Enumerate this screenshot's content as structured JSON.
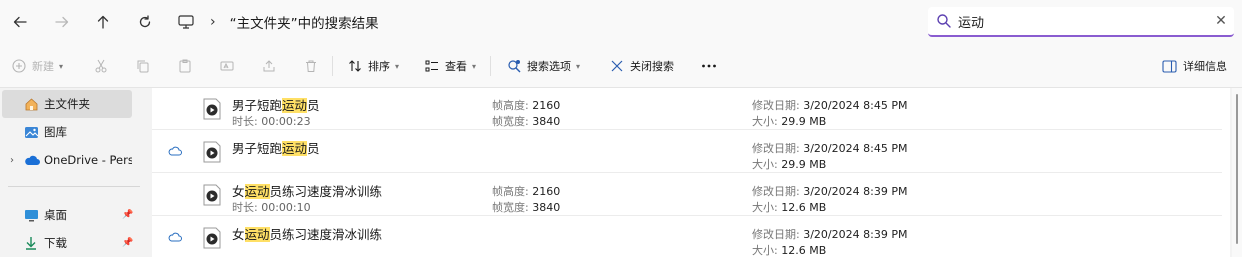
{
  "address": {
    "path": "“主文件夹”中的搜索结果"
  },
  "search": {
    "query": "运动"
  },
  "toolbar": {
    "new_label": "新建",
    "sort_label": "排序",
    "view_label": "查看",
    "search_options_label": "搜索选项",
    "close_search_label": "关闭搜索",
    "details_label": "详细信息"
  },
  "nav": {
    "home": "主文件夹",
    "gallery": "图库",
    "onedrive": "OneDrive - Persor",
    "desktop": "桌面",
    "downloads": "下载"
  },
  "files": [
    {
      "name_pre": "男子短跑",
      "name_hl": "运动",
      "name_post": "员",
      "has_duration": true,
      "duration_label": "时长:",
      "duration": "00:00:23",
      "has_dims": true,
      "height_label": "帧高度:",
      "height": "2160",
      "width_label": "帧宽度:",
      "width": "3840",
      "modified_label": "修改日期:",
      "modified": "3/20/2024 8:45 PM",
      "size_label": "大小:",
      "size": "29.9 MB",
      "cloud": false
    },
    {
      "name_pre": "男子短跑",
      "name_hl": "运动",
      "name_post": "员",
      "has_duration": false,
      "has_dims": false,
      "modified_label": "修改日期:",
      "modified": "3/20/2024 8:45 PM",
      "size_label": "大小:",
      "size": "29.9 MB",
      "cloud": true
    },
    {
      "name_pre": "女",
      "name_hl": "运动",
      "name_post": "员练习速度滑冰训练",
      "has_duration": true,
      "duration_label": "时长:",
      "duration": "00:00:10",
      "has_dims": true,
      "height_label": "帧高度:",
      "height": "2160",
      "width_label": "帧宽度:",
      "width": "3840",
      "modified_label": "修改日期:",
      "modified": "3/20/2024 8:39 PM",
      "size_label": "大小:",
      "size": "12.6 MB",
      "cloud": false
    },
    {
      "name_pre": "女",
      "name_hl": "运动",
      "name_post": "员练习速度滑冰训练",
      "has_duration": false,
      "has_dims": false,
      "modified_label": "修改日期:",
      "modified": "3/20/2024 8:39 PM",
      "size_label": "大小:",
      "size": "12.6 MB",
      "cloud": true
    }
  ],
  "colors": {
    "accent": "#8a5cd0",
    "highlight": "#ffe066",
    "selected": "#dcdcdc"
  }
}
